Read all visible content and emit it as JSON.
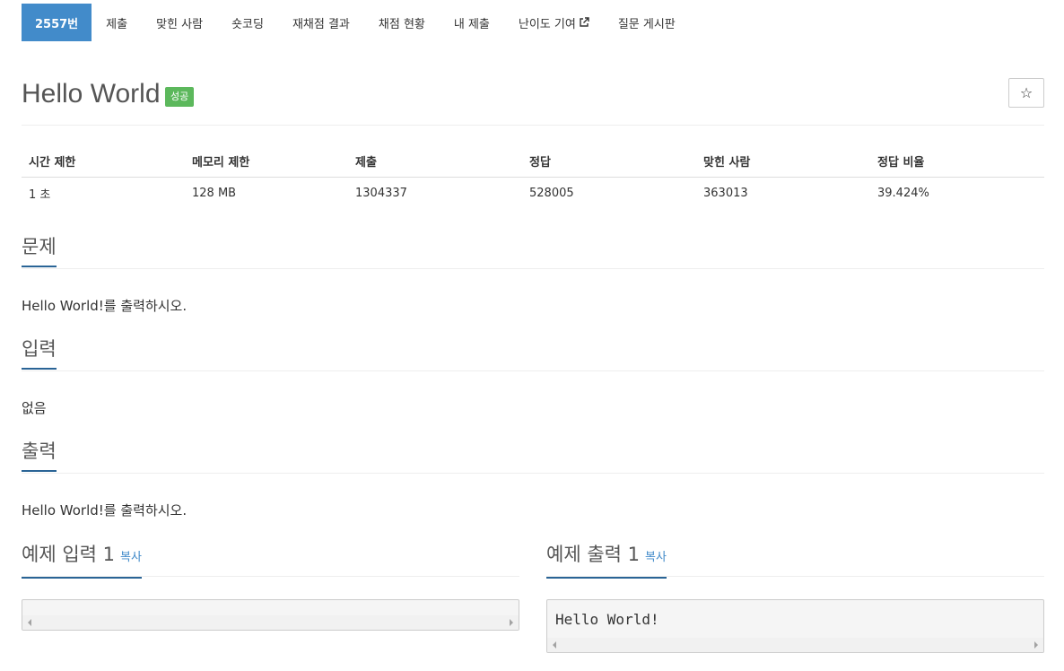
{
  "nav": {
    "items": [
      {
        "label": "2557번",
        "active": true
      },
      {
        "label": "제출"
      },
      {
        "label": "맞힌 사람"
      },
      {
        "label": "숏코딩"
      },
      {
        "label": "재채점 결과"
      },
      {
        "label": "채점 현황"
      },
      {
        "label": "내 제출"
      },
      {
        "label": "난이도 기여",
        "external": true
      },
      {
        "label": "질문 게시판"
      }
    ]
  },
  "problem": {
    "title": "Hello World",
    "badge": "성공",
    "star": "☆"
  },
  "info_table": {
    "headers": [
      "시간 제한",
      "메모리 제한",
      "제출",
      "정답",
      "맞힌 사람",
      "정답 비율"
    ],
    "row": [
      "1 초",
      "128 MB",
      "1304337",
      "528005",
      "363013",
      "39.424%"
    ]
  },
  "sections": {
    "problem_head": "문제",
    "problem_text": "Hello World!를 출력하시오.",
    "input_head": "입력",
    "input_text": "없음",
    "output_head": "출력",
    "output_text": "Hello World!를 출력하시오."
  },
  "samples": {
    "input_head": "예제 입력 1",
    "output_head": "예제 출력 1",
    "copy_label": "복사",
    "input_value": "",
    "output_value": "Hello World!"
  }
}
